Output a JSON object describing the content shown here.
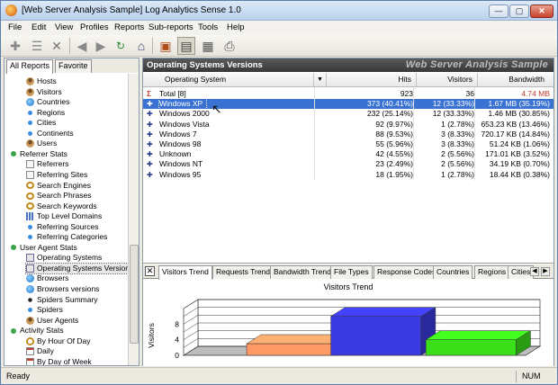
{
  "window": {
    "title": "[Web Server Analysis Sample] Log Analytics Sense 1.0",
    "min": "—",
    "max": "▢",
    "close": "✕"
  },
  "menu": [
    "File",
    "Edit",
    "View",
    "Profiles",
    "Reports",
    "Sub-reports",
    "Tools",
    "Help"
  ],
  "toolbar": [
    "add-icon",
    "list-icon",
    "delete-icon",
    "back-icon",
    "forward-icon",
    "refresh-icon",
    "home-icon",
    "report-icon",
    "view-icon",
    "export-icon",
    "print-icon"
  ],
  "left_tabs": {
    "all": "All Reports",
    "fav": "Favorite"
  },
  "tree": [
    {
      "label": "Hosts",
      "level": 2,
      "icon": "person"
    },
    {
      "label": "Visitors",
      "level": 2,
      "icon": "person"
    },
    {
      "label": "Countries",
      "level": 2,
      "icon": "globe"
    },
    {
      "label": "Regions",
      "level": 2,
      "icon": "dot"
    },
    {
      "label": "Cities",
      "level": 2,
      "icon": "dot"
    },
    {
      "label": "Continents",
      "level": 2,
      "icon": "dot"
    },
    {
      "label": "Users",
      "level": 2,
      "icon": "person"
    },
    {
      "label": "Referrer Stats",
      "level": 1,
      "icon": "group"
    },
    {
      "label": "Referrers",
      "level": 2,
      "icon": "page"
    },
    {
      "label": "Referring Sites",
      "level": 2,
      "icon": "page"
    },
    {
      "label": "Search Engines",
      "level": 2,
      "icon": "search"
    },
    {
      "label": "Search Phrases",
      "level": 2,
      "icon": "search"
    },
    {
      "label": "Search Keywords",
      "level": 2,
      "icon": "search"
    },
    {
      "label": "Top Level Domains",
      "level": 2,
      "icon": "grid"
    },
    {
      "label": "Referring Sources",
      "level": 2,
      "icon": "dot"
    },
    {
      "label": "Referring Categories",
      "level": 2,
      "icon": "dot"
    },
    {
      "label": "User Agent Stats",
      "level": 1,
      "icon": "group"
    },
    {
      "label": "Operating Systems",
      "level": 2,
      "icon": "os"
    },
    {
      "label": "Operating Systems Version",
      "level": 2,
      "icon": "os"
    },
    {
      "label": "Browsers",
      "level": 2,
      "icon": "globe"
    },
    {
      "label": "Browsers versions",
      "level": 2,
      "icon": "globe"
    },
    {
      "label": "Spiders Summary",
      "level": 2,
      "icon": "spider"
    },
    {
      "label": "Spiders",
      "level": 2,
      "icon": "dot"
    },
    {
      "label": "User Agents",
      "level": 2,
      "icon": "person"
    },
    {
      "label": "Activity Stats",
      "level": 1,
      "icon": "group"
    },
    {
      "label": "By Hour Of Day",
      "level": 2,
      "icon": "clock"
    },
    {
      "label": "Daily",
      "level": 2,
      "icon": "cal"
    },
    {
      "label": "By Day of Week",
      "level": 2,
      "icon": "cal"
    }
  ],
  "report": {
    "title": "Operating Systems Versions",
    "brand": "Web Server Analysis Sample"
  },
  "columns": {
    "os": "Operating System",
    "sort": "▼",
    "hits": "Hits",
    "visitors": "Visitors",
    "bandwidth": "Bandwidth"
  },
  "rows": [
    {
      "os": "Total [8]",
      "hits": "923",
      "visitors": "36",
      "bandwidth": "4.74 MB",
      "total": true
    },
    {
      "os": "Windows XP",
      "hits": "373 (40.41%)",
      "visitors": "12 (33.33%)",
      "bandwidth": "1.67 MB (35.19%)",
      "selected": true
    },
    {
      "os": "Windows 2000",
      "hits": "232 (25.14%)",
      "visitors": "12 (33.33%)",
      "bandwidth": "1.46 MB (30.85%)"
    },
    {
      "os": "Windows Vista",
      "hits": "92 (9.97%)",
      "visitors": "1 (2.78%)",
      "bandwidth": "653.23 KB (13.46%)"
    },
    {
      "os": "Windows 7",
      "hits": "88 (9.53%)",
      "visitors": "3 (8.33%)",
      "bandwidth": "720.17 KB (14.84%)"
    },
    {
      "os": "Windows 98",
      "hits": "55 (5.96%)",
      "visitors": "3 (8.33%)",
      "bandwidth": "51.24 KB (1.06%)"
    },
    {
      "os": "Unknown",
      "hits": "42 (4.55%)",
      "visitors": "2 (5.56%)",
      "bandwidth": "171.01 KB (3.52%)"
    },
    {
      "os": "Windows NT",
      "hits": "23 (2.49%)",
      "visitors": "2 (5.56%)",
      "bandwidth": "34.19 KB (0.70%)"
    },
    {
      "os": "Windows 95",
      "hits": "18 (1.95%)",
      "visitors": "1 (2.78%)",
      "bandwidth": "18.44 KB (0.38%)"
    }
  ],
  "bottom_tabs": [
    "Visitors Trend",
    "Requests Trend",
    "Bandwidth Trend",
    "File Types",
    "Response Codes",
    "Countries",
    "Regions",
    "Cities"
  ],
  "chart_data": {
    "type": "bar",
    "title": "Visitors Trend",
    "ylabel": "Visitors",
    "yticks": [
      "0",
      "4",
      "8"
    ],
    "ylim": [
      0,
      12
    ],
    "values": [
      3,
      10,
      4
    ],
    "colors": [
      "#ff9a66",
      "#3a3ae0",
      "#3adf1a"
    ]
  },
  "status": {
    "ready": "Ready",
    "num": "NUM"
  }
}
